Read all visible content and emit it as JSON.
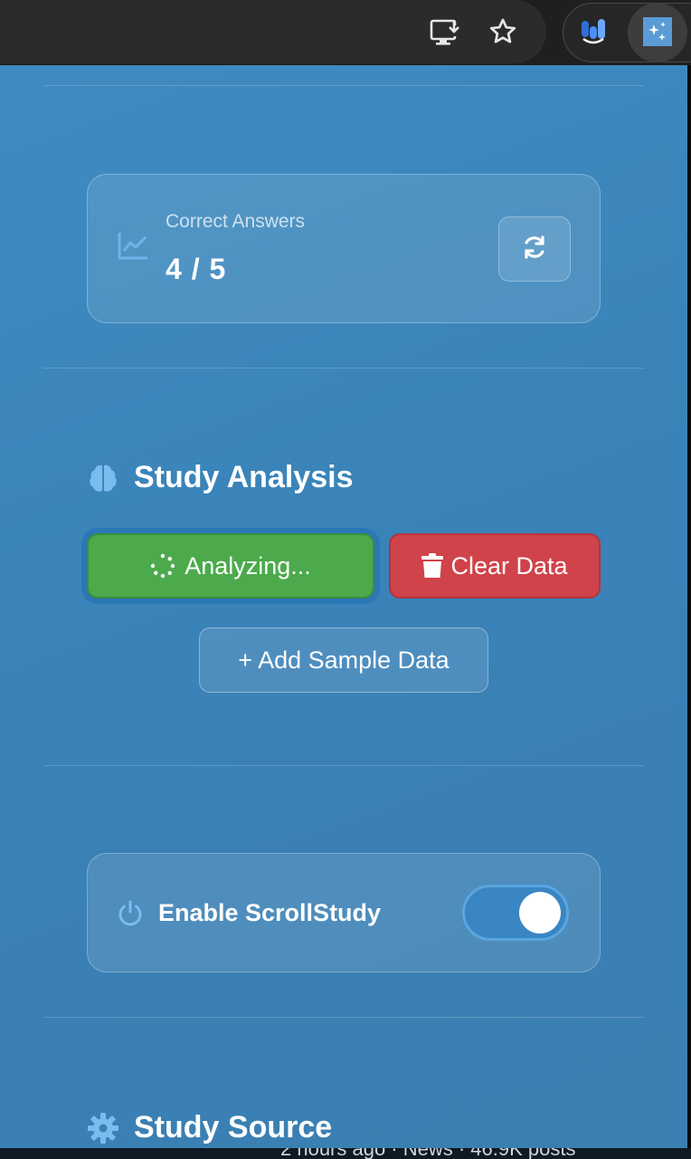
{
  "browser": {
    "toolbar_icons": [
      "install-app-icon",
      "bookmark-star-icon",
      "extension-icon",
      "scrollstudy-extension-icon"
    ]
  },
  "stats": {
    "label": "Correct Answers",
    "value": "4 / 5"
  },
  "study_analysis": {
    "title": "Study Analysis",
    "analyze_label": "Analyzing...",
    "clear_label": "Clear Data",
    "sample_label": "+ Add Sample Data"
  },
  "enable": {
    "label": "Enable ScrollStudy",
    "enabled": true
  },
  "study_source": {
    "title": "Study Source"
  },
  "background_peek": {
    "text": "2 hours ago · News · 46.9K posts"
  },
  "colors": {
    "panel_bg": "#3a84b9",
    "analyze_btn": "#4caa4c",
    "clear_btn": "#d0434a",
    "toggle_on": "#3a86c2"
  }
}
